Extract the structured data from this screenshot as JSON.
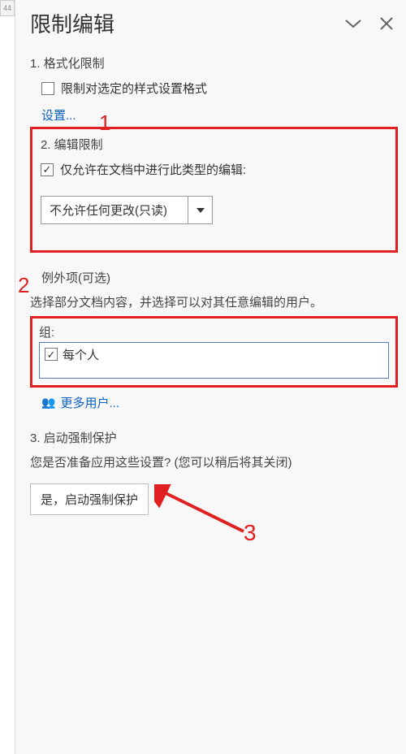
{
  "side_tab": "44",
  "header": {
    "title": "限制编辑"
  },
  "section1": {
    "heading": "1. 格式化限制",
    "checkbox_label": "限制对选定的样式设置格式",
    "settings_link": "设置..."
  },
  "section2": {
    "heading": "2. 编辑限制",
    "checkbox_label": "仅允许在文档中进行此类型的编辑:",
    "dropdown_selected": "不允许任何更改(只读)"
  },
  "exceptions": {
    "heading": "例外项(可选)",
    "instruction": "选择部分文档内容，并选择可以对其任意编辑的用户。",
    "group_label": "组:",
    "group_option": "每个人",
    "more_users": "更多用户..."
  },
  "section3": {
    "heading": "3. 启动强制保护",
    "question": "您是否准备应用这些设置? (您可以稍后将其关闭)",
    "button_label": "是，启动强制保护"
  },
  "annotations": {
    "n1": "1",
    "n2": "2",
    "n3": "3"
  }
}
